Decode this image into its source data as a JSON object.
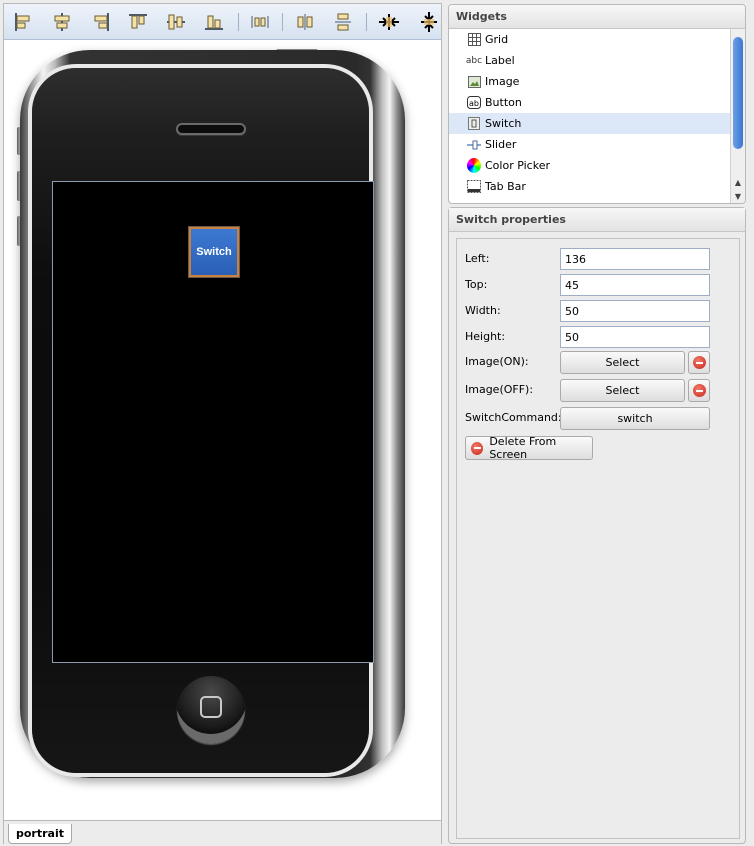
{
  "designer": {
    "toolbar": [
      {
        "name": "align-left-icon"
      },
      {
        "name": "align-center-horizontal-icon"
      },
      {
        "name": "align-right-icon"
      },
      {
        "name": "align-top-icon"
      },
      {
        "name": "align-middle-vertical-icon"
      },
      {
        "name": "align-bottom-icon"
      },
      {
        "name": "distribute-horizontal-icon"
      },
      {
        "name": "distribute-center-icon"
      },
      {
        "name": "distribute-vertical-icon"
      },
      {
        "name": "same-width-icon"
      },
      {
        "name": "same-height-icon"
      }
    ],
    "screen_widget_label": "Switch",
    "tab_label": "portrait"
  },
  "widgets_panel": {
    "title": "Widgets",
    "items": [
      {
        "label": "Grid",
        "icon": "grid-icon"
      },
      {
        "label": "Label",
        "icon": "label-icon"
      },
      {
        "label": "Image",
        "icon": "image-icon"
      },
      {
        "label": "Button",
        "icon": "button-icon"
      },
      {
        "label": "Switch",
        "icon": "switch-icon",
        "selected": true
      },
      {
        "label": "Slider",
        "icon": "slider-icon"
      },
      {
        "label": "Color Picker",
        "icon": "color-picker-icon"
      },
      {
        "label": "Tab Bar",
        "icon": "tab-bar-icon"
      }
    ]
  },
  "props_panel": {
    "title": "Switch properties",
    "left_label": "Left:",
    "left_value": "136",
    "top_label": "Top:",
    "top_value": "45",
    "width_label": "Width:",
    "width_value": "50",
    "height_label": "Height:",
    "height_value": "50",
    "image_on_label": "Image(ON):",
    "image_on_button": "Select",
    "image_off_label": "Image(OFF):",
    "image_off_button": "Select",
    "command_label": "SwitchCommand:",
    "command_button": "switch",
    "delete_label": "Delete From Screen"
  }
}
